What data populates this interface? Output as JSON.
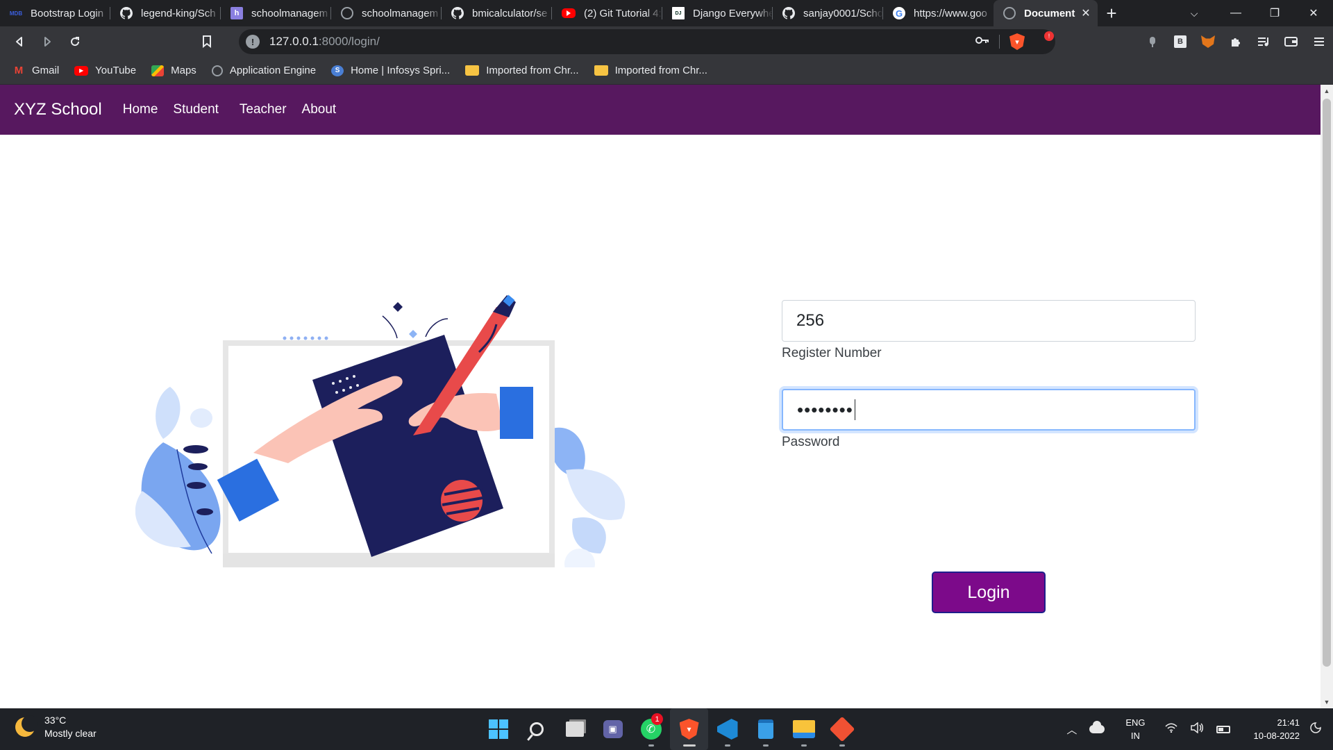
{
  "browser": {
    "tabs": [
      {
        "label": "Bootstrap Login",
        "icon": "mdb-icon",
        "icon_text": "MDB"
      },
      {
        "label": "legend-king/Sch",
        "icon": "github-icon"
      },
      {
        "label": "schoolmanagem",
        "icon": "document-icon",
        "icon_text": "h"
      },
      {
        "label": "schoolmanagem",
        "icon": "globe-icon"
      },
      {
        "label": "bmicalculator/se",
        "icon": "github-icon"
      },
      {
        "label": "(2) Git Tutorial 4:",
        "icon": "youtube-icon"
      },
      {
        "label": "Django Everywhe",
        "icon": "django-icon",
        "icon_text": "DJ"
      },
      {
        "label": "sanjay0001/Scho",
        "icon": "github-icon"
      },
      {
        "label": "https://www.goo",
        "icon": "google-icon",
        "icon_text": "G"
      },
      {
        "label": "Document",
        "icon": "globe-icon",
        "active": true
      }
    ],
    "new_tab_symbol": "+",
    "window_controls": {
      "tab_search": "⌵",
      "minimize": "—",
      "maximize": "❐",
      "close": "✕"
    },
    "address": {
      "host": "127.0.0.1",
      "path": ":8000/login/"
    },
    "extensions": [
      "camera-icon",
      "bitwarden-icon",
      "metamask-icon",
      "extensions-icon",
      "playlist-icon",
      "wallet-icon",
      "menu-icon"
    ],
    "bookmarks": [
      {
        "label": "Gmail",
        "icon": "gmail-icon"
      },
      {
        "label": "YouTube",
        "icon": "youtube-icon"
      },
      {
        "label": "Maps",
        "icon": "maps-icon"
      },
      {
        "label": "Application Engine",
        "icon": "globe-icon"
      },
      {
        "label": "Home | Infosys Spri...",
        "icon": "infosys-icon"
      },
      {
        "label": "Imported from Chr...",
        "icon": "folder-icon"
      },
      {
        "label": "Imported from Chr...",
        "icon": "folder-icon"
      }
    ]
  },
  "site": {
    "brand": "XYZ School",
    "nav": [
      "Home",
      "Student",
      "Teacher",
      "About"
    ],
    "colors": {
      "navbar": "#57185f",
      "button": "#7c0a8a"
    }
  },
  "login": {
    "register_value": "256",
    "register_label": "Register Number",
    "password_masked": "••••••••",
    "password_label": "Password",
    "submit_label": "Login"
  },
  "taskbar": {
    "weather_temp": "33°C",
    "weather_desc": "Mostly clear",
    "apps": [
      "windows-start-icon",
      "search-icon",
      "task-view-icon",
      "teams-chat-icon",
      "whatsapp-icon",
      "brave-icon",
      "vscode-icon",
      "notepad-icon",
      "file-explorer-icon",
      "git-icon"
    ],
    "whatsapp_badge": "1",
    "lang_primary": "ENG",
    "lang_secondary": "IN",
    "time": "21:41",
    "date": "10-08-2022"
  }
}
